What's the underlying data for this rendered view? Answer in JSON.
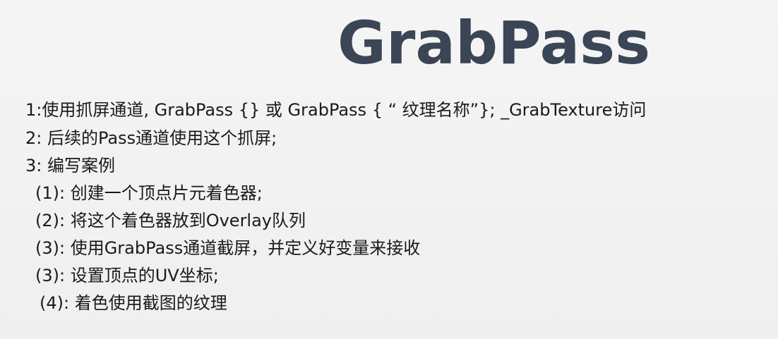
{
  "slide": {
    "title": "GrabPass",
    "lines": [
      "1:使用抓屏通道, GrabPass {} 或 GrabPass { “ 纹理名称”}; _GrabTexture访问",
      "2: 后续的Pass通道使用这个抓屏;",
      "3: 编写案例",
      "(1): 创建一个顶点片元着色器;",
      "(2): 将这个着色器放到Overlay队列",
      "(3): 使用GrabPass通道截屏，并定义好变量来接收",
      "(3): 设置顶点的UV坐标;",
      "(4): 着色使用截图的纹理"
    ]
  }
}
